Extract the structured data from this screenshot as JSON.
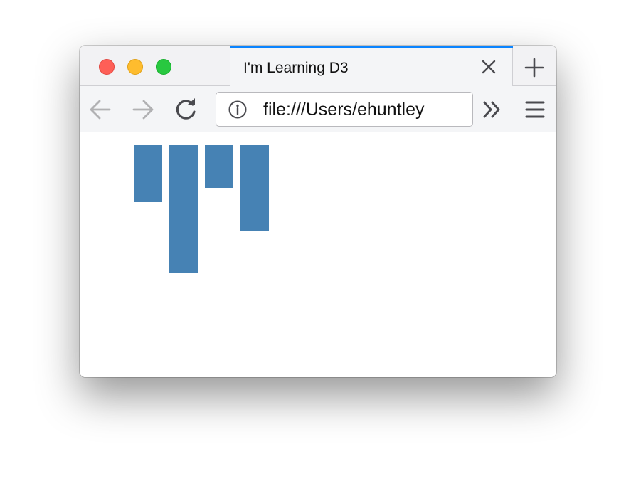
{
  "window": {
    "buttons": [
      "close",
      "minimize",
      "zoom"
    ]
  },
  "tab": {
    "title": "I'm Learning D3",
    "close_icon": "close-icon",
    "accent_color": "#0a84ff"
  },
  "toolbar": {
    "back_icon": "arrow-left-icon",
    "forward_icon": "arrow-right-icon",
    "reload_icon": "reload-icon",
    "overflow_icon": "double-chevron-right-icon",
    "menu_icon": "hamburger-menu-icon",
    "new_tab_icon": "plus-icon"
  },
  "urlbar": {
    "info_icon": "info-icon",
    "url": "file:///Users/ehuntley"
  },
  "chart_data": {
    "type": "bar",
    "orientation": "vertical-downward",
    "values": [
      80,
      180,
      60,
      120
    ],
    "color": "#4682b4"
  }
}
